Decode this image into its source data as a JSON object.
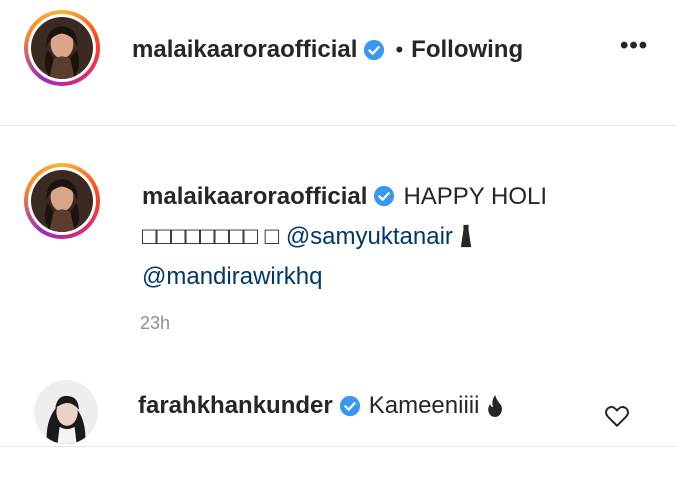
{
  "header": {
    "username": "malaikaaroraofficial",
    "separator": "•",
    "follow_status": "Following",
    "more_label": "•••"
  },
  "caption": {
    "username": "malaikaaroraofficial",
    "text_start": "HAPPY HOLI",
    "glyph_line": "□□□□□□□□ □",
    "mention1": "@samyuktanair",
    "mention2": "@mandirawirkhq",
    "timestamp": "23h"
  },
  "comment": {
    "username": "farahkhankunder",
    "text": "Kameeniiii"
  },
  "colors": {
    "text": "#262626",
    "verified": "#3897f0",
    "mention": "#00376b",
    "timestamp": "#8e8e8e"
  },
  "icons": [
    "verified-badge-icon",
    "more-options-icon",
    "dress-emoji-icon",
    "fire-emoji-icon",
    "heart-icon"
  ]
}
